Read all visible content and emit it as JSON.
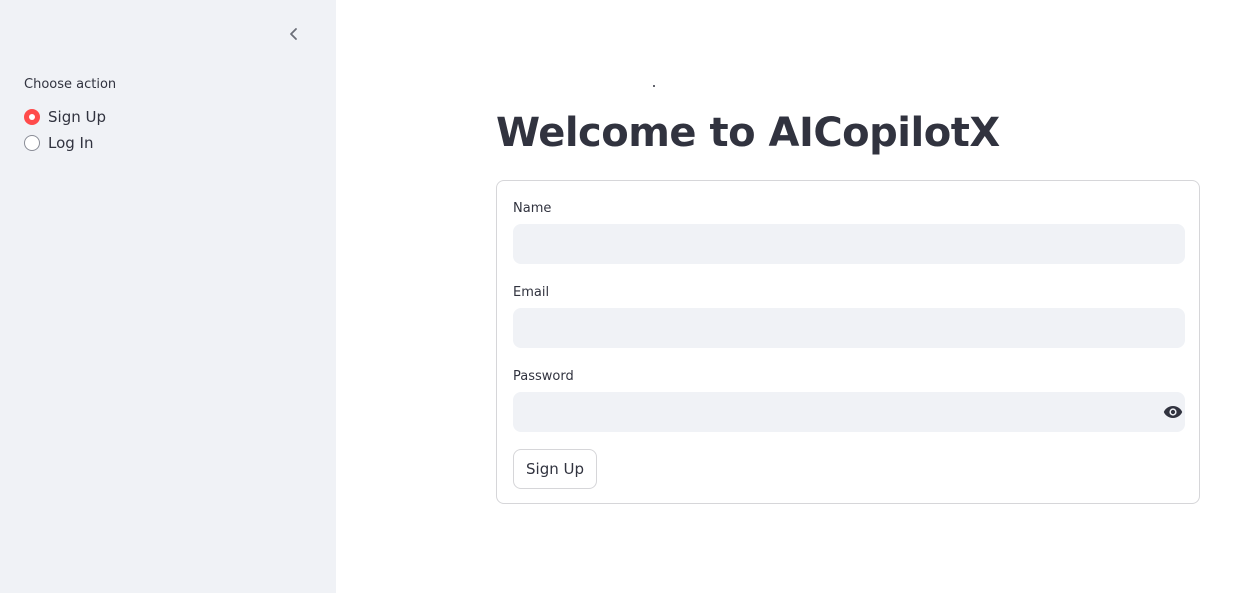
{
  "sidebar": {
    "collapse_icon": "chevron-left-icon",
    "action_label": "Choose action",
    "options": [
      {
        "label": "Sign Up",
        "selected": true
      },
      {
        "label": "Log In",
        "selected": false
      }
    ],
    "accent_color": "#ff4b4b"
  },
  "main": {
    "title": "Welcome to AICopilotX",
    "form": {
      "name_label": "Name",
      "name_value": "",
      "email_label": "Email",
      "email_value": "",
      "password_label": "Password",
      "password_value": "",
      "password_toggle_icon": "eye-icon",
      "submit_label": "Sign Up"
    }
  },
  "colors": {
    "sidebar_bg": "#f0f2f6",
    "text": "#31333f",
    "input_bg": "#f0f2f6",
    "border": "#d6d6d9"
  }
}
